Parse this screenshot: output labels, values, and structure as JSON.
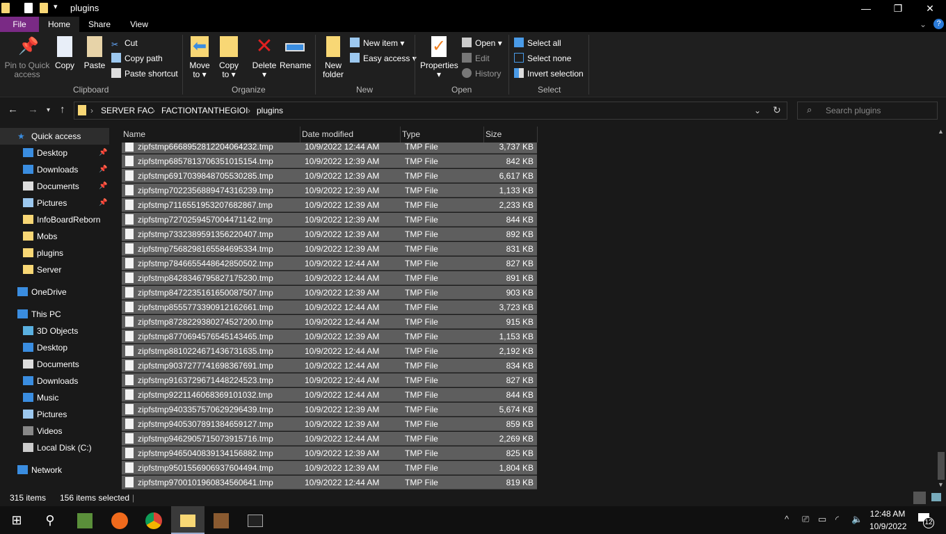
{
  "window": {
    "title": "plugins"
  },
  "tabs": {
    "file": "File",
    "home": "Home",
    "share": "Share",
    "view": "View"
  },
  "ribbon": {
    "pin_l1": "Pin to Quick",
    "pin_l2": "access",
    "copy": "Copy",
    "paste": "Paste",
    "cut": "Cut",
    "copy_path": "Copy path",
    "paste_shortcut": "Paste shortcut",
    "clipboard": "Clipboard",
    "move_l1": "Move",
    "move_l2": "to ▾",
    "copyto_l1": "Copy",
    "copyto_l2": "to ▾",
    "delete": "Delete",
    "delete_arrow": "▾",
    "rename": "Rename",
    "organize": "Organize",
    "newfolder_l1": "New",
    "newfolder_l2": "folder",
    "new_item": "New item ▾",
    "easy_access": "Easy access ▾",
    "new": "New",
    "properties": "Properties",
    "properties_arrow": "▾",
    "open": "Open ▾",
    "edit": "Edit",
    "history": "History",
    "open_group": "Open",
    "select_all": "Select all",
    "select_none": "Select none",
    "invert_selection": "Invert selection",
    "select": "Select"
  },
  "address": {
    "crumbs": [
      "SERVER FAC",
      "FACTIONTANTHEGIOI",
      "plugins"
    ],
    "search_placeholder": "Search plugins"
  },
  "sidebar": {
    "items": [
      {
        "label": "Quick access",
        "pinned": false
      },
      {
        "label": "Desktop",
        "pinned": true
      },
      {
        "label": "Downloads",
        "pinned": true
      },
      {
        "label": "Documents",
        "pinned": true
      },
      {
        "label": "Pictures",
        "pinned": true
      },
      {
        "label": "InfoBoardReborn"
      },
      {
        "label": "Mobs"
      },
      {
        "label": "plugins"
      },
      {
        "label": "Server"
      },
      {
        "label": "OneDrive"
      },
      {
        "label": "This PC"
      },
      {
        "label": "3D Objects"
      },
      {
        "label": "Desktop"
      },
      {
        "label": "Documents"
      },
      {
        "label": "Downloads"
      },
      {
        "label": "Music"
      },
      {
        "label": "Pictures"
      },
      {
        "label": "Videos"
      },
      {
        "label": "Local Disk (C:)"
      },
      {
        "label": "Network"
      }
    ]
  },
  "columns": {
    "name": "Name",
    "date": "Date modified",
    "type": "Type",
    "size": "Size"
  },
  "files": [
    {
      "name": "zipfstmp6668952812204064232.tmp",
      "date": "10/9/2022 12:44 AM",
      "type": "TMP File",
      "size": "3,737 KB"
    },
    {
      "name": "zipfstmp6857813706351015154.tmp",
      "date": "10/9/2022 12:39 AM",
      "type": "TMP File",
      "size": "842 KB"
    },
    {
      "name": "zipfstmp6917039848705530285.tmp",
      "date": "10/9/2022 12:39 AM",
      "type": "TMP File",
      "size": "6,617 KB"
    },
    {
      "name": "zipfstmp7022356889474316239.tmp",
      "date": "10/9/2022 12:39 AM",
      "type": "TMP File",
      "size": "1,133 KB"
    },
    {
      "name": "zipfstmp7116551953207682867.tmp",
      "date": "10/9/2022 12:39 AM",
      "type": "TMP File",
      "size": "2,233 KB"
    },
    {
      "name": "zipfstmp7270259457004471142.tmp",
      "date": "10/9/2022 12:39 AM",
      "type": "TMP File",
      "size": "844 KB"
    },
    {
      "name": "zipfstmp7332389591356220407.tmp",
      "date": "10/9/2022 12:39 AM",
      "type": "TMP File",
      "size": "892 KB"
    },
    {
      "name": "zipfstmp7568298165584695334.tmp",
      "date": "10/9/2022 12:39 AM",
      "type": "TMP File",
      "size": "831 KB"
    },
    {
      "name": "zipfstmp7846655448642850502.tmp",
      "date": "10/9/2022 12:44 AM",
      "type": "TMP File",
      "size": "827 KB"
    },
    {
      "name": "zipfstmp8428346795827175230.tmp",
      "date": "10/9/2022 12:44 AM",
      "type": "TMP File",
      "size": "891 KB"
    },
    {
      "name": "zipfstmp8472235161650087507.tmp",
      "date": "10/9/2022 12:39 AM",
      "type": "TMP File",
      "size": "903 KB"
    },
    {
      "name": "zipfstmp8555773390912162661.tmp",
      "date": "10/9/2022 12:44 AM",
      "type": "TMP File",
      "size": "3,723 KB"
    },
    {
      "name": "zipfstmp8728229380274527200.tmp",
      "date": "10/9/2022 12:44 AM",
      "type": "TMP File",
      "size": "915 KB"
    },
    {
      "name": "zipfstmp8770694576545143465.tmp",
      "date": "10/9/2022 12:39 AM",
      "type": "TMP File",
      "size": "1,153 KB"
    },
    {
      "name": "zipfstmp8810224671436731635.tmp",
      "date": "10/9/2022 12:44 AM",
      "type": "TMP File",
      "size": "2,192 KB"
    },
    {
      "name": "zipfstmp9037277741698367691.tmp",
      "date": "10/9/2022 12:44 AM",
      "type": "TMP File",
      "size": "834 KB"
    },
    {
      "name": "zipfstmp9163729671448224523.tmp",
      "date": "10/9/2022 12:44 AM",
      "type": "TMP File",
      "size": "827 KB"
    },
    {
      "name": "zipfstmp9221146068369101032.tmp",
      "date": "10/9/2022 12:44 AM",
      "type": "TMP File",
      "size": "844 KB"
    },
    {
      "name": "zipfstmp9403357570629296439.tmp",
      "date": "10/9/2022 12:39 AM",
      "type": "TMP File",
      "size": "5,674 KB"
    },
    {
      "name": "zipfstmp9405307891384659127.tmp",
      "date": "10/9/2022 12:39 AM",
      "type": "TMP File",
      "size": "859 KB"
    },
    {
      "name": "zipfstmp9462905715073915716.tmp",
      "date": "10/9/2022 12:44 AM",
      "type": "TMP File",
      "size": "2,269 KB"
    },
    {
      "name": "zipfstmp9465040839134156882.tmp",
      "date": "10/9/2022 12:39 AM",
      "type": "TMP File",
      "size": "825 KB"
    },
    {
      "name": "zipfstmp9501556906937604494.tmp",
      "date": "10/9/2022 12:39 AM",
      "type": "TMP File",
      "size": "1,804 KB"
    },
    {
      "name": "zipfstmp9700101960834560641.tmp",
      "date": "10/9/2022 12:44 AM",
      "type": "TMP File",
      "size": "819 KB"
    }
  ],
  "status": {
    "items": "315 items",
    "selected": "156 items selected"
  },
  "taskbar": {
    "time": "12:48 AM",
    "date": "10/9/2022",
    "notifications": "12"
  },
  "colors": {
    "accent_file_tab": "#7a2a85",
    "selection": "#5e5e5e"
  }
}
